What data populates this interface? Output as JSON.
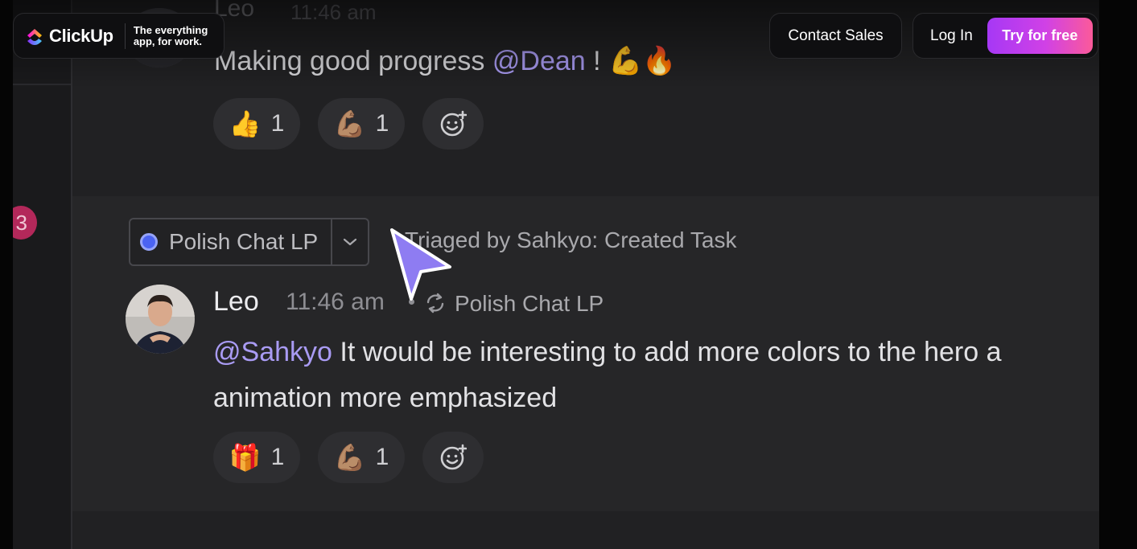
{
  "header": {
    "brand": "ClickUp",
    "tagline": "The everything app, for work.",
    "contact_label": "Contact Sales",
    "login_label": "Log In",
    "cta_label": "Try for free"
  },
  "prev_message": {
    "author": "Leo",
    "time": "11:46 am",
    "text_before": "Making good progress ",
    "mention": "@Dean",
    "text_after": " ! 💪🔥",
    "reactions": [
      {
        "emoji": "👍",
        "count": "1"
      },
      {
        "emoji": "💪🏽",
        "count": "1"
      }
    ]
  },
  "sidebar": {
    "badge_count": "3"
  },
  "task_link": {
    "task_name": "Polish Chat LP",
    "status_color": "#4b63f2",
    "triage_text": "Triaged by Sahkyo: Created Task"
  },
  "message": {
    "author": "Leo",
    "time": "11:46 am",
    "linked_task": "Polish Chat LP",
    "mention": "@Sahkyo",
    "line1": " It would be interesting to add more colors to the hero a",
    "line2": "animation more emphasized",
    "reactions": [
      {
        "emoji": "🎁",
        "count": "1"
      },
      {
        "emoji": "💪🏽",
        "count": "1"
      }
    ]
  },
  "icons": {
    "add_reaction": "add-reaction-icon",
    "caret": "chevron-down-icon",
    "sync": "sync-icon",
    "cursor": "pointer-cursor-icon"
  }
}
